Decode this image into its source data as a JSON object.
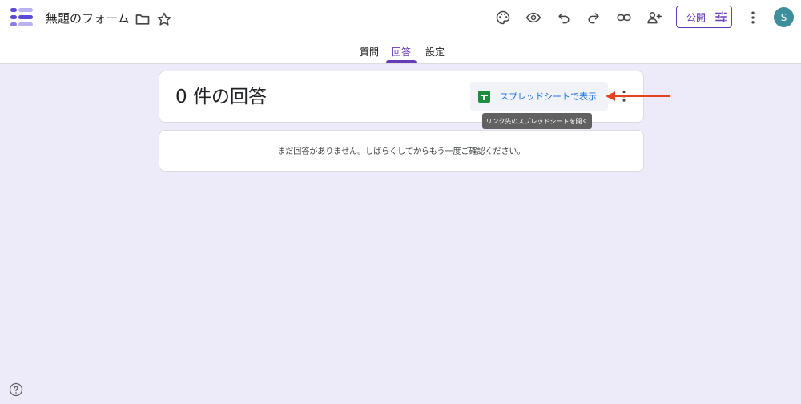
{
  "app": {
    "title": "無題のフォーム",
    "logo_icon": "forms-logo-icon",
    "accent_color": "#673ab7"
  },
  "toolbar": {
    "icons": [
      "palette-icon",
      "eye-icon",
      "undo-icon",
      "redo-icon",
      "link-icon",
      "add-person-icon",
      "more-vert-icon"
    ],
    "publish_label": "公開",
    "avatar_initial": "S"
  },
  "tabs": [
    {
      "label": "質問",
      "active": false
    },
    {
      "label": "回答",
      "active": true
    },
    {
      "label": "設定",
      "active": false
    }
  ],
  "responses": {
    "count_title": "0 件の回答",
    "sheet_button_label": "スプレッドシートで表示",
    "sheet_tooltip": "リンク先のスプレッドシートを開く",
    "empty_message": "まだ回答がありません。しばらくしてからもう一度ご確認ください。"
  },
  "annotation": {
    "arrow_color": "#e8411f"
  }
}
